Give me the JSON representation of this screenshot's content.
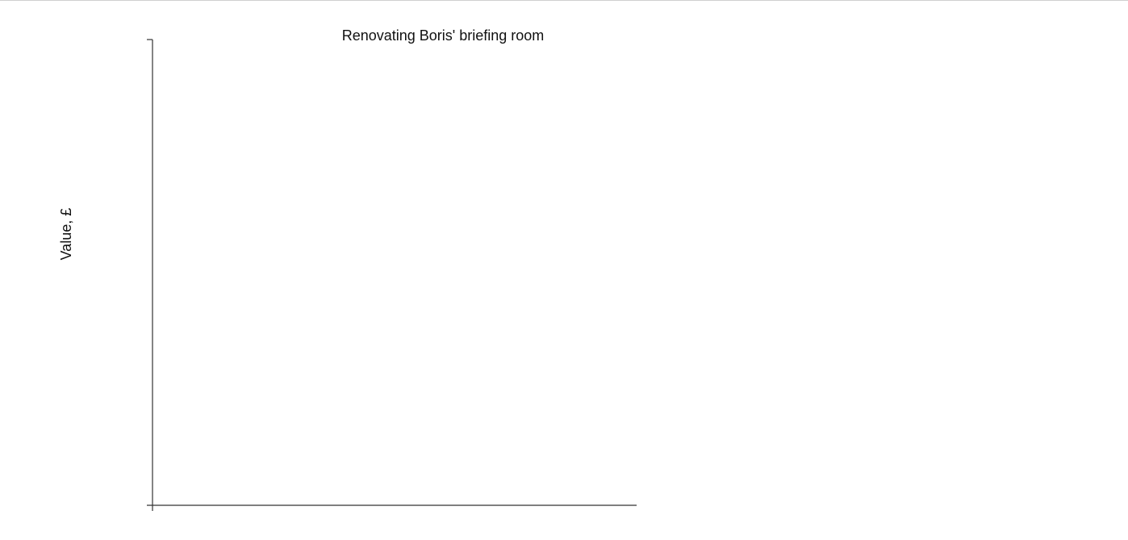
{
  "chart_data": {
    "type": "bar",
    "title": "Renovating Boris' briefing room",
    "xlabel": "",
    "ylabel": "Value, £",
    "categories": [],
    "values": [],
    "grid": false
  }
}
